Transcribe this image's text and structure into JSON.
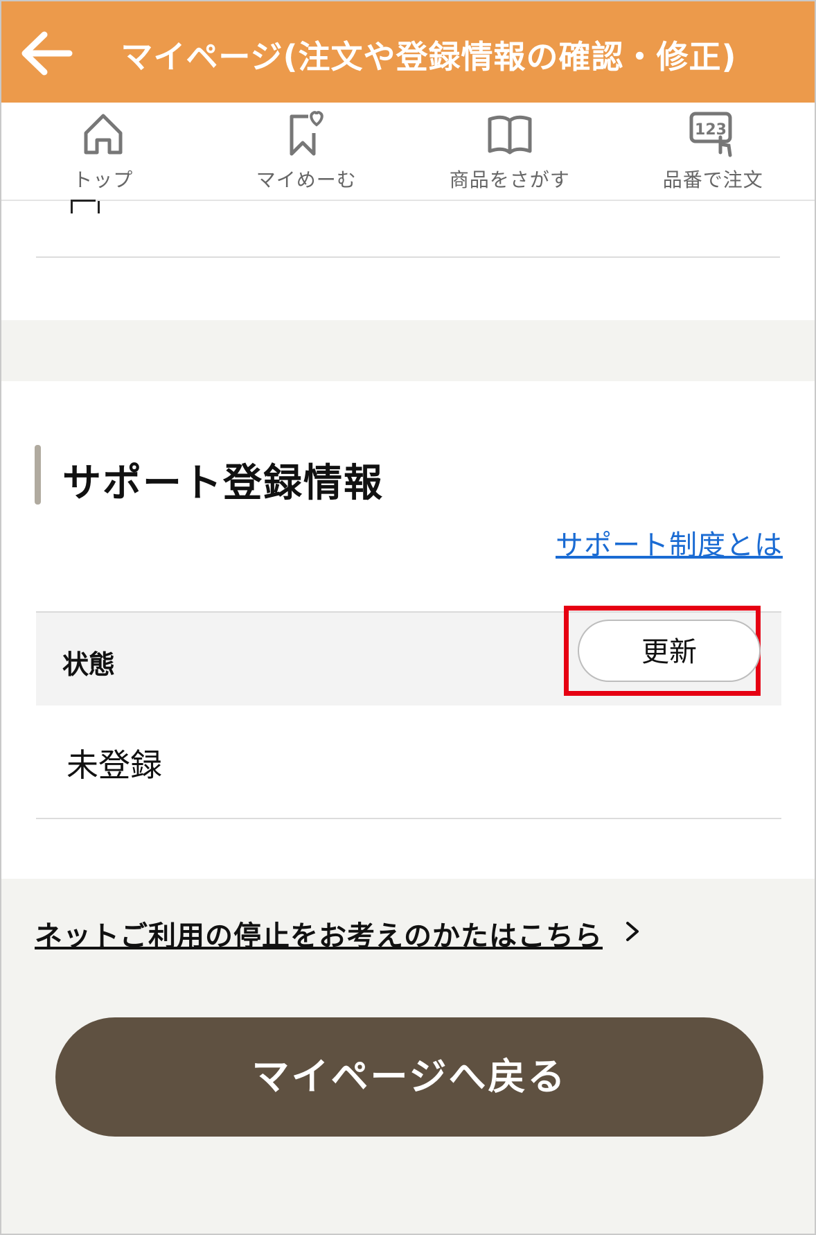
{
  "header": {
    "title": "マイページ(注文や登録情報の確認・修正)",
    "back_icon": "arrow-left-icon",
    "background": "#ec9a4b"
  },
  "nav": {
    "items": [
      {
        "label": "トップ",
        "icon": "home-icon"
      },
      {
        "label": "マイめーむ",
        "icon": "bookmark-heart-icon"
      },
      {
        "label": "商品をさがす",
        "icon": "book-icon"
      },
      {
        "label": "品番で注文",
        "icon": "number-tap-icon"
      }
    ]
  },
  "support": {
    "title": "サポート登録情報",
    "link": "サポート制度とは",
    "status_label": "状態",
    "update_button": "更新",
    "status_value": "未登録"
  },
  "footer": {
    "stop_link": "ネットご利用の停止をお考えのかたはこちら",
    "back_button": "マイページへ戻る",
    "back_button_color": "#5f5141"
  }
}
